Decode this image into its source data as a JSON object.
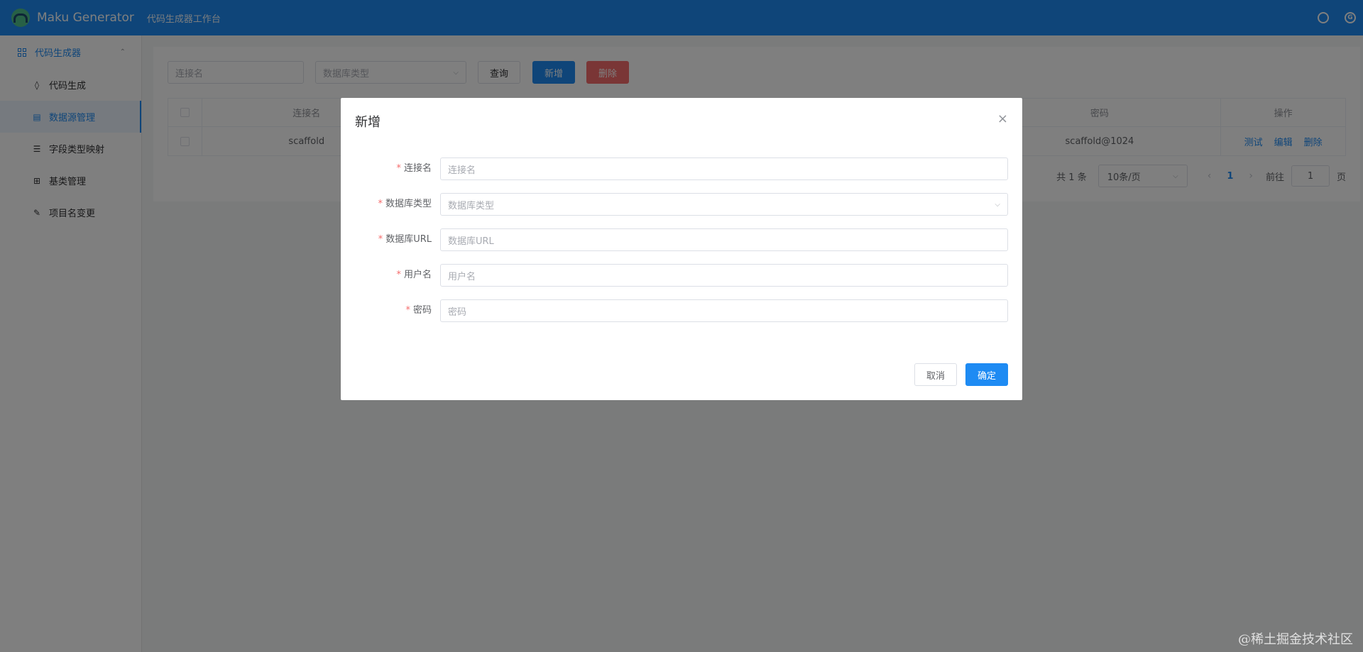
{
  "header": {
    "app_name": "Maku Generator",
    "subtitle": "代码生成器工作台",
    "github_icon_glyph": "",
    "gitee_icon_glyph": "G",
    "accent_color": "#1e8bf3"
  },
  "sidebar": {
    "group_label": "代码生成器",
    "group_chevron": "⌃",
    "items": [
      {
        "label": "代码生成",
        "icon": "◊"
      },
      {
        "label": "数据源管理",
        "icon": "▤"
      },
      {
        "label": "字段类型映射",
        "icon": "☰"
      },
      {
        "label": "基类管理",
        "icon": "⊞"
      },
      {
        "label": "项目名变更",
        "icon": "✎"
      }
    ]
  },
  "search": {
    "conn_placeholder": "连接名",
    "dbtype_placeholder": "数据库类型",
    "query_label": "查询",
    "add_label": "新增",
    "delete_label": "删除"
  },
  "table": {
    "columns": [
      "",
      "连接名",
      "",
      "",
      "",
      "",
      "密码",
      "操作"
    ],
    "rows": [
      {
        "conn_name": "scaffold",
        "password": "scaffold@1024",
        "actions": [
          "测试",
          "编辑",
          "删除"
        ]
      }
    ]
  },
  "pagination": {
    "total": "共 1 条",
    "page_size": "10条/页",
    "current_page": "1",
    "goto_label": "前往",
    "goto_value": "1",
    "page_suffix": "页"
  },
  "dialog": {
    "title": "新增",
    "close_glyph": "×",
    "fields": [
      {
        "label": "连接名",
        "placeholder": "连接名",
        "required_mark": "*"
      },
      {
        "label": "数据库类型",
        "placeholder": "数据库类型",
        "required_mark": "*"
      },
      {
        "label": "数据库URL",
        "placeholder": "数据库URL",
        "required_mark": "*"
      },
      {
        "label": "用户名",
        "placeholder": "用户名",
        "required_mark": "*"
      },
      {
        "label": "密码",
        "placeholder": "密码",
        "required_mark": "*"
      }
    ],
    "cancel_label": "取消",
    "confirm_label": "确定"
  },
  "watermark": "@稀土掘金技术社区"
}
